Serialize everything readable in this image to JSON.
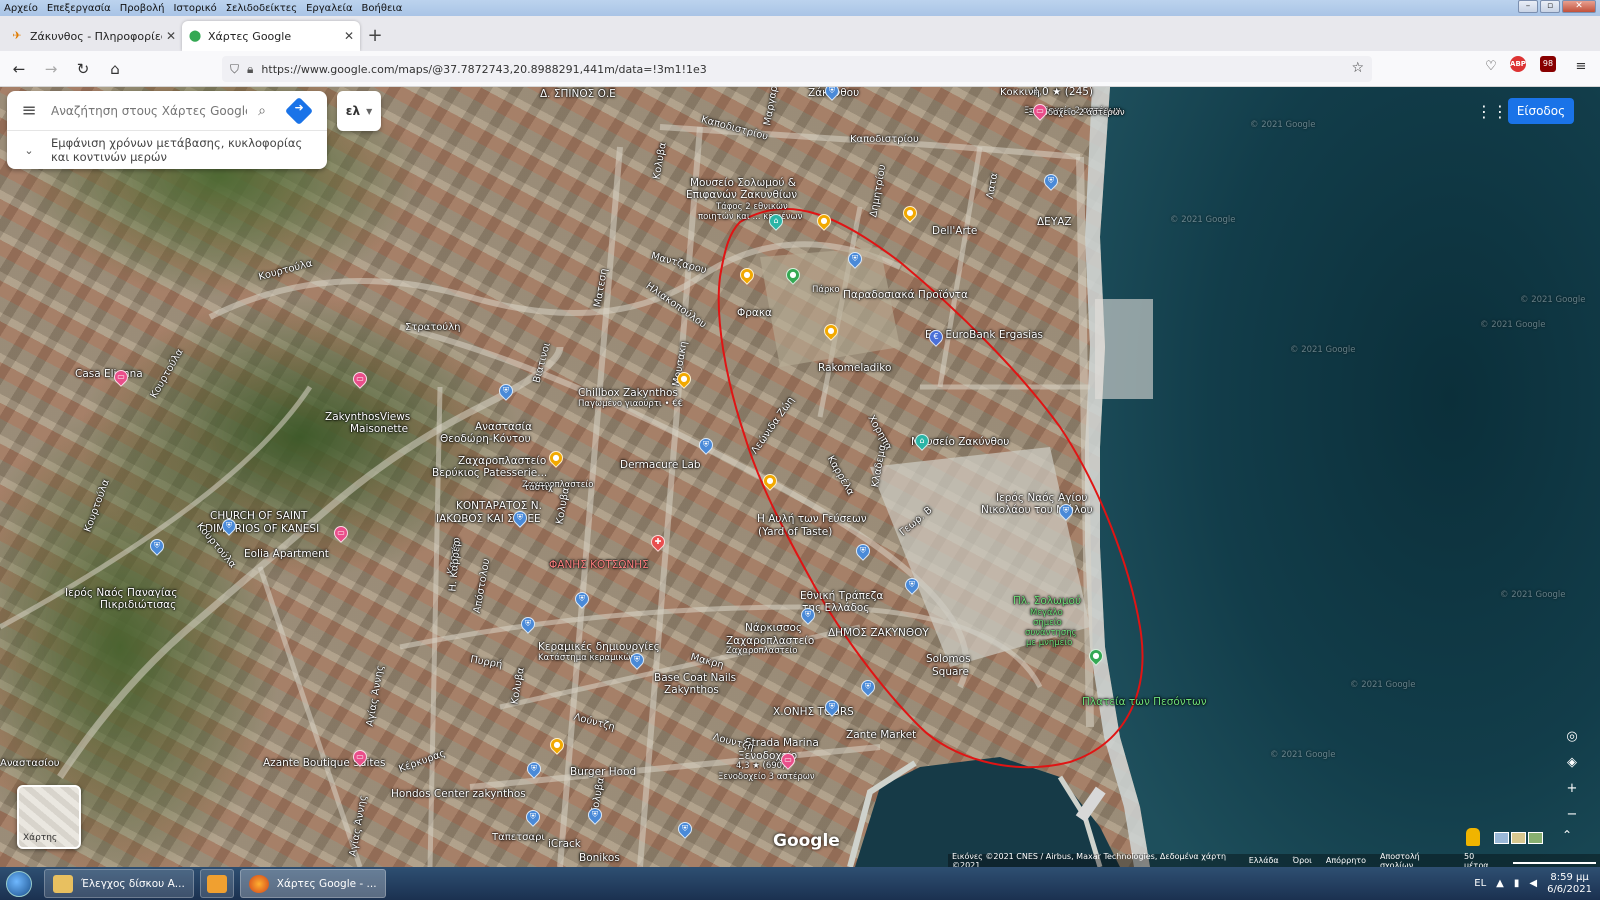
{
  "menubar": [
    "Αρχείο",
    "Επεξεργασία",
    "Προβολή",
    "Ιστορικό",
    "Σελιδοδείκτες",
    "Εργαλεία",
    "Βοήθεια"
  ],
  "tabs": [
    {
      "title": "Ζάκυνθος - Πληροφορίες για Ζ"
    },
    {
      "title": "Χάρτες Google"
    }
  ],
  "nav": {
    "url": "https://www.google.com/maps/@37.7872743,20.8988291,441m/data=!3m1!1e3",
    "ub_count": "98"
  },
  "search": {
    "placeholder": "Αναζήτηση στους Χάρτες Google",
    "expand_text": "Εμφάνιση χρόνων μετάβασης, κυκλοφορίας και κοντινών μερών"
  },
  "lang": "ελ",
  "signin": "Είσοδος",
  "layer_label": "Χάρτης",
  "google_logo": "Google",
  "attribution": [
    "Εικόνες ©2021 CNES / Airbus, Maxar Technologies, Δεδομένα χάρτη ©2021",
    "Ελλάδα",
    "Όροι",
    "Απόρρητο",
    "Αποστολή σχολίων",
    "50 μέτρα"
  ],
  "map_labels": [
    {
      "t": "Δ. ΣΠΙΝΟΣ Ο.Ε"
    },
    {
      "t": "Ζάκυνθου"
    },
    {
      "t": "Καποδιστρίου"
    },
    {
      "t": "Καποδιστρίου"
    },
    {
      "t": "Μουσείο Σολωμού &"
    },
    {
      "t": "Επιφανών Ζακυνθίων"
    },
    {
      "t": "Τάφος 2 εθνικών"
    },
    {
      "t": "ποιητών και ... κειμένων"
    },
    {
      "t": "Dell'Arte"
    },
    {
      "t": "ΔΕΥΑΖ"
    },
    {
      "t": "Μαντζαρου"
    },
    {
      "t": "Κουρτούλα"
    },
    {
      "t": "Στρατούλη"
    },
    {
      "t": "Φρακα"
    },
    {
      "t": "Πάρκο"
    },
    {
      "t": "Παραδοσιακά Προϊόντα"
    },
    {
      "t": "Efg EuroBank Ergasias"
    },
    {
      "t": "Ηλιακοπούλου"
    },
    {
      "t": "Rakomeladiko"
    },
    {
      "t": "Chillbox Zakynthos"
    },
    {
      "t": "Παγωμένο γιαούρτι • €€"
    },
    {
      "t": "Casa Elianna"
    },
    {
      "t": "ZakynthosViews"
    },
    {
      "t": "Maisonette"
    },
    {
      "t": "Αναστασία"
    },
    {
      "t": "Θεοδώρη-Κόντου"
    },
    {
      "t": "Ζαχαροπλαστείο"
    },
    {
      "t": "Βερύκιος Patesserie..."
    },
    {
      "t": "Ζαχαροπλαστείο"
    },
    {
      "t": "Dermacure Lab"
    },
    {
      "t": "Μουσείο Ζακύνθου"
    },
    {
      "t": "Ιερός Ναός Αγίου"
    },
    {
      "t": "Νικολάου του Μώλου"
    },
    {
      "t": "ΚΟΝΤΑΡΑΤΟΣ Ν."
    },
    {
      "t": "ΙΑΚΩΒΟΣ ΚΑΙ ΣΙΑ ΕΕ"
    },
    {
      "t": "Η Αυλή των Γεύσεων"
    },
    {
      "t": "(Yard of Taste)"
    },
    {
      "t": "CHURCH OF SAINT"
    },
    {
      "t": "DIMITRIOS OF KANESI"
    },
    {
      "t": "Eolia Apartment"
    },
    {
      "t": "ΦΑΝΗΣ ΚΟΤΣΩΝΗΣ"
    },
    {
      "t": "Ιερός Ναός Παναγίας"
    },
    {
      "t": "Πικριδιώτισας"
    },
    {
      "t": "Εθνική Τράπεζα"
    },
    {
      "t": "της Ελλάδος"
    },
    {
      "t": "Πλ. Σολωμού"
    },
    {
      "t": "Μεγάλο"
    },
    {
      "t": "σημείο"
    },
    {
      "t": "συνάντησης"
    },
    {
      "t": "με μνημείο"
    },
    {
      "t": "Νάρκισσος"
    },
    {
      "t": "Ζαχαροπλαστείο"
    },
    {
      "t": "Ζαχαροπλαστείο"
    },
    {
      "t": "ΔΗΜΟΣ ΖΑΚΥΝΘΟΥ"
    },
    {
      "t": "Κεραμικές δημιουργίες"
    },
    {
      "t": "Κατάστημα κεραμικών"
    },
    {
      "t": "Solomos"
    },
    {
      "t": "Square"
    },
    {
      "t": "Πλατεία των Πεσόντων"
    },
    {
      "t": "Base Coat Nails"
    },
    {
      "t": "Zakynthos"
    },
    {
      "t": "Χ.ΟΝΗΣ TOURS"
    },
    {
      "t": "Zante Market"
    },
    {
      "t": "Azante Boutique Suites"
    },
    {
      "t": "Burger Hood"
    },
    {
      "t": "Strada Marina"
    },
    {
      "t": "Ξενοδοχείο"
    },
    {
      "t": "4,3 ★ (690)"
    },
    {
      "t": "Ξενοδοχείο 3 αστέρων"
    },
    {
      "t": "Hondos Center zakynthos"
    },
    {
      "t": "iCrack"
    },
    {
      "t": "Bonikos"
    },
    {
      "t": "Κουρτούλα"
    },
    {
      "t": "Κουρτούλα"
    },
    {
      "t": "Κουρτούλα"
    },
    {
      "t": "Αναστασίου"
    },
    {
      "t": "Κέρκυρας"
    },
    {
      "t": "Λούντζη"
    },
    {
      "t": "Λουντζη"
    },
    {
      "t": "Κολυβα"
    },
    {
      "t": "Κολυβα"
    },
    {
      "t": "Ματεση"
    },
    {
      "t": "Βιατινοι"
    },
    {
      "t": "Λεώνιδα Ζώη"
    },
    {
      "t": "Καρρέλα"
    },
    {
      "t": "Χορηπα"
    },
    {
      "t": "Γεωρ. Β"
    },
    {
      "t": "Μακρη"
    },
    {
      "t": "Πυρρή"
    },
    {
      "t": "Αγίας Άννης"
    },
    {
      "t": "Αγίας Άννης"
    },
    {
      "t": "Μαργαρίτη"
    },
    {
      "t": "4,0 ★ (245)"
    },
    {
      "t": "Ξενοδοχείο 2 αστέρων"
    },
    {
      "t": "Απόστολου"
    },
    {
      "t": "Κολυβα"
    },
    {
      "t": "Κολυβα"
    },
    {
      "t": "ταστιχ"
    },
    {
      "t": "Καρρερ"
    },
    {
      "t": "Μουσακη"
    },
    {
      "t": "Δημητρίου"
    },
    {
      "t": "Κλαδεμα"
    },
    {
      "t": "Η. Καρρέρ"
    },
    {
      "t": "Ταπετσαρι"
    },
    {
      "t": "Κοκκινη"
    },
    {
      "t": "Λατα"
    },
    {
      "t": "Ξενοδοχείο 2 αστέρων"
    },
    {
      "t": "© 2021 Google"
    },
    {
      "t": "© 2021 Google"
    },
    {
      "t": "© 2021 Google"
    },
    {
      "t": "© 2021 Google"
    },
    {
      "t": "© 2021 Google"
    },
    {
      "t": "© 2021 Google"
    },
    {
      "t": "© 2021 Google"
    },
    {
      "t": "© 2021 Google"
    }
  ],
  "taskbar": {
    "items": [
      "Έλεγχος δίσκου Α...",
      "",
      "Χάρτες Google - ..."
    ],
    "lang": "EL",
    "time": "8:59 μμ",
    "date": "6/6/2021"
  }
}
